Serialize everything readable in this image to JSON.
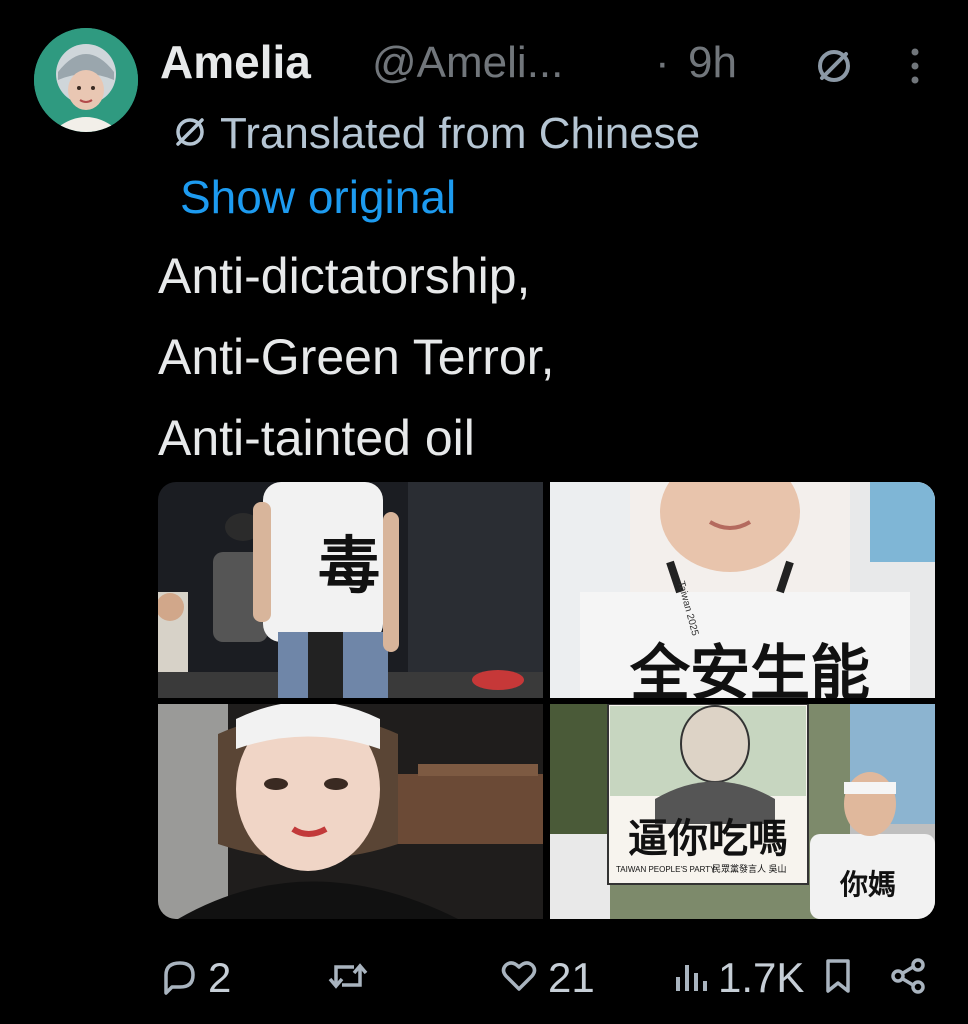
{
  "author": {
    "name": "Amelia",
    "handle": "@Ameli...",
    "separator": "·",
    "time": "9h",
    "avatar_icon": "avatar-photo"
  },
  "translation": {
    "label": "Translated from Chinese",
    "show_original": "Show original"
  },
  "tweet": {
    "lines": [
      "Anti-dictatorship,",
      "Anti-Green Terror,",
      "Anti-tainted oil"
    ]
  },
  "media": {
    "photo1": {
      "shirt_glyph": "毒"
    },
    "photo2": {
      "sign_text": "全安生能",
      "lanyard_text": "Taiwan 2025"
    },
    "photo3": {},
    "photo4": {
      "poster_main": "逼你吃嗎",
      "poster_party": "TAIWAN PEOPLE'S PARTY",
      "poster_speaker": "民眾黨發言人 吳山",
      "shirt_text": "你媽"
    }
  },
  "actions": {
    "replies": "2",
    "reposts": "",
    "likes": "21",
    "views": "1.7K"
  },
  "colors": {
    "background": "#000000",
    "text": "#e7e9ea",
    "muted": "#71767b",
    "link": "#1d9bf0"
  }
}
